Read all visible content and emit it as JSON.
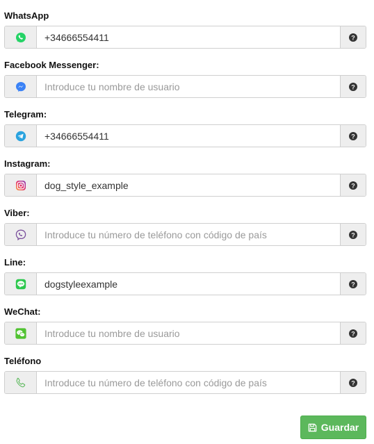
{
  "fields": [
    {
      "label": "WhatsApp",
      "value": "+34666554411",
      "placeholder": "",
      "icon": "whatsapp-icon",
      "color": "#25d366"
    },
    {
      "label": "Facebook Messenger:",
      "value": "",
      "placeholder": "Introduce tu nombre de usuario",
      "icon": "messenger-icon",
      "color": "#3b82f6"
    },
    {
      "label": "Telegram:",
      "value": "+34666554411",
      "placeholder": "",
      "icon": "telegram-icon",
      "color": "#2aa3df"
    },
    {
      "label": "Instagram:",
      "value": "dog_style_example",
      "placeholder": "",
      "icon": "instagram-icon",
      "color": "#c13584"
    },
    {
      "label": "Viber:",
      "value": "",
      "placeholder": "Introduce tu número de teléfono con código de país",
      "icon": "viber-icon",
      "color": "#7b519d"
    },
    {
      "label": "Line:",
      "value": "dogstyleexample",
      "placeholder": "",
      "icon": "line-icon",
      "color": "#2cc84d"
    },
    {
      "label": "WeChat:",
      "value": "",
      "placeholder": "Introduce tu nombre de usuario",
      "icon": "wechat-icon",
      "color": "#51c332"
    },
    {
      "label": "Teléfono",
      "value": "",
      "placeholder": "Introduce tu número de teléfono con código de país",
      "icon": "phone-icon",
      "color": "#5cb85c"
    }
  ],
  "help_icon": "question-circle-icon",
  "save_button": {
    "label": "Guardar",
    "icon": "floppy-disk-icon",
    "color": "#5cb85c"
  }
}
